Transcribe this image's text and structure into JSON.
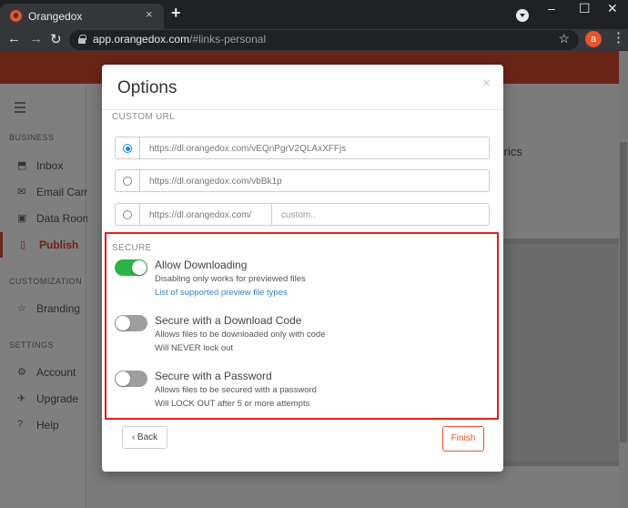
{
  "browser": {
    "tab_title": "Orangedox",
    "tab_close": "×",
    "new_tab": "+",
    "url_host": "app.orangedox.com",
    "url_path": "/#links-personal",
    "profile_initial": "a",
    "window_controls": {
      "minimize": "–",
      "maximize": "☐",
      "close": "✕"
    }
  },
  "banner": {
    "text": ""
  },
  "sidebar": {
    "sections": [
      {
        "label": "BUSINESS",
        "items": [
          {
            "label": "Inbox",
            "icon": "inbox-icon",
            "glyph": "⬒"
          },
          {
            "label": "Email Campai",
            "icon": "email-icon",
            "glyph": "✉"
          },
          {
            "label": "Data Rooms",
            "icon": "data-rooms-icon",
            "glyph": "▣"
          },
          {
            "label": "Publish",
            "icon": "publish-icon",
            "glyph": "▯",
            "active": true
          }
        ]
      },
      {
        "label": "CUSTOMIZATION",
        "items": [
          {
            "label": "Branding",
            "icon": "star-icon",
            "glyph": "☆"
          }
        ]
      },
      {
        "label": "SETTINGS",
        "items": [
          {
            "label": "Account",
            "icon": "gear-icon",
            "glyph": "⚙"
          },
          {
            "label": "Upgrade",
            "icon": "rocket-icon",
            "glyph": "✈"
          },
          {
            "label": "Help",
            "icon": "help-icon",
            "glyph": "?"
          }
        ]
      }
    ]
  },
  "main": {
    "hint_text": "trics"
  },
  "modal": {
    "title": "Options",
    "close": "×",
    "custom_url": {
      "label": "CUSTOM URL",
      "options": [
        {
          "url": "https://dl.orangedox.com/vEQnPgrV2QLAxXFFjs",
          "checked": true
        },
        {
          "url": "https://dl.orangedox.com/vbBk1p",
          "checked": false
        }
      ],
      "custom_prefix": "https://dl.orangedox.com/",
      "custom_placeholder": "custom.."
    },
    "secure": {
      "label": "SECURE",
      "toggles": [
        {
          "title": "Allow Downloading",
          "on": true,
          "line1": "Disabling only works for previewed files",
          "link": "List of supported preview file types"
        },
        {
          "title": "Secure with a Download Code",
          "on": false,
          "line1": "Allows files to be downloaded only with code",
          "line2": "Will NEVER lock out"
        },
        {
          "title": "Secure with a Password",
          "on": false,
          "line1": "Allows files to be secured with a password",
          "line2": "Will LOCK OUT after 5 or more attempts"
        }
      ]
    },
    "buttons": {
      "back": "‹ Back",
      "finish": "Finish"
    }
  },
  "colors": {
    "brand": "#e8542a",
    "banner": "#d44a2f",
    "toggle_on": "#2db34a",
    "highlight_border": "#e01e1e",
    "link": "#3a82c4"
  }
}
